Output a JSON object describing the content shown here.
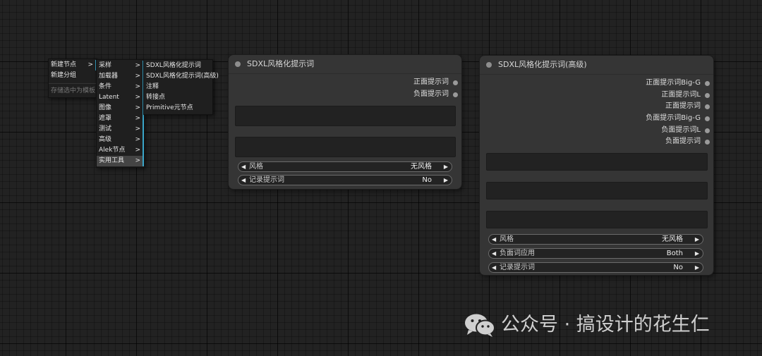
{
  "menu1": {
    "items": [
      {
        "label": "新建节点",
        "submenu": true
      },
      {
        "label": "新建分组"
      },
      {
        "label": "存储选中为模板",
        "disabled": true
      }
    ]
  },
  "menu2": {
    "items": [
      {
        "label": "采样"
      },
      {
        "label": "加载器"
      },
      {
        "label": "条件"
      },
      {
        "label": "Latent"
      },
      {
        "label": "图像"
      },
      {
        "label": "遮罩"
      },
      {
        "label": "测试"
      },
      {
        "label": "高级"
      },
      {
        "label": "Alek节点"
      },
      {
        "label": "实用工具"
      }
    ],
    "arrow": ">"
  },
  "menu3": {
    "items": [
      {
        "label": "SDXL风格化提示词"
      },
      {
        "label": "SDXL风格化提示词(高级)"
      },
      {
        "label": "注释"
      },
      {
        "label": "转接点"
      },
      {
        "label": "Primitive元节点"
      }
    ]
  },
  "node1": {
    "title": "SDXL风格化提示词",
    "outputs": [
      "正面提示词",
      "负面提示词"
    ],
    "widgets": [
      {
        "label": "风格",
        "value": "无风格"
      },
      {
        "label": "记录提示词",
        "value": "No"
      }
    ]
  },
  "node2": {
    "title": "SDXL风格化提示词(高级)",
    "outputs": [
      "正面提示词Big-G",
      "正面提示词L",
      "正面提示词",
      "负面提示词Big-G",
      "负面提示词L",
      "负面提示词"
    ],
    "widgets": [
      {
        "label": "风格",
        "value": "无风格"
      },
      {
        "label": "负面词应用",
        "value": "Both"
      },
      {
        "label": "记录提示词",
        "value": "No"
      }
    ]
  },
  "widget_arrows": {
    "left": "◀",
    "right": "▶"
  },
  "watermark": {
    "text": "公众号 · 搞设计的花生仁",
    "icon": "wechat-icon"
  },
  "colors": {
    "canvas": "#222222",
    "node": "#353535",
    "menu_accent": "#3aa6c9"
  }
}
